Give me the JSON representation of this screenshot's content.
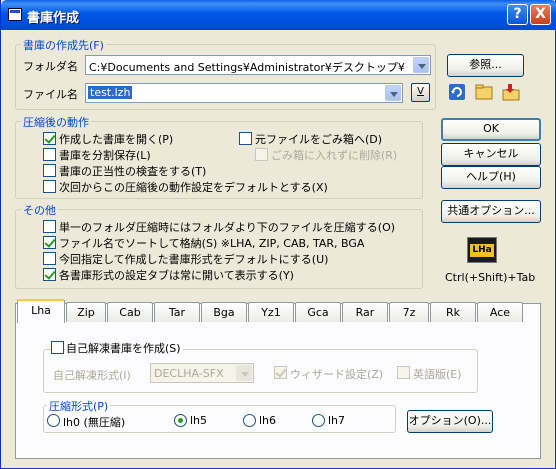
{
  "window": {
    "title": "書庫作成",
    "help_btn": "?",
    "close_btn": "X"
  },
  "dest": {
    "group_label": "書庫の作成先(F)",
    "folder_label": "フォルダ名",
    "folder_value": "C:¥Documents and Settings¥Administrator¥デスクトップ¥",
    "browse_label": "参照...",
    "file_label": "ファイル名",
    "file_value": "test.lzh",
    "v_label": "V"
  },
  "after": {
    "group_label": "圧縮後の動作",
    "items": [
      {
        "label": "作成した書庫を開く(P)",
        "checked": true
      },
      {
        "label": "書庫を分割保存(L)",
        "checked": false
      },
      {
        "label": "書庫の正当性の検査をする(T)",
        "checked": false
      },
      {
        "label": "次回からこの圧縮後の動作設定をデフォルトとする(X)",
        "checked": false
      },
      {
        "label": "元ファイルをごみ箱へ(D)",
        "checked": false
      },
      {
        "label": "ごみ箱に入れずに削除(R)",
        "checked": false
      }
    ]
  },
  "other": {
    "group_label": "その他",
    "items": [
      {
        "label": "単一のフォルダ圧縮時にはフォルダより下のファイルを圧縮する(O)",
        "checked": false
      },
      {
        "label": "ファイル名でソートして格納(S)  ※LHA, ZIP, CAB, TAR, BGA",
        "checked": true
      },
      {
        "label": "今回指定して作成した書庫形式をデフォルトにする(U)",
        "checked": false
      },
      {
        "label": "各書庫形式の設定タブは常に開いて表示する(Y)",
        "checked": true
      }
    ]
  },
  "buttons": {
    "ok": "OK",
    "cancel": "キャンセル",
    "help": "ヘルプ(H)",
    "common_options": "共通オプション...",
    "shortcut": "Ctrl(+Shift)+Tab",
    "lha_logo": "LHa"
  },
  "tabs": [
    "Lha",
    "Zip",
    "Cab",
    "Tar",
    "Bga",
    "Yz1",
    "Gca",
    "Rar",
    "7z",
    "Rk",
    "Ace"
  ],
  "lha_tab": {
    "selfextract_label": "自己解凍書庫を作成(S)",
    "format_label": "自己解凍形式(I)",
    "format_value": "DECLHA-SFX",
    "wizard_label": "ウィザード設定(Z)",
    "english_label": "英語版(E)",
    "compress_group": "圧縮形式(P)",
    "radios": [
      {
        "label": "lh0 (無圧縮)",
        "selected": false
      },
      {
        "label": "lh5",
        "selected": true
      },
      {
        "label": "lh6",
        "selected": false
      },
      {
        "label": "lh7",
        "selected": false
      }
    ],
    "options_button": "オプション(O)..."
  }
}
